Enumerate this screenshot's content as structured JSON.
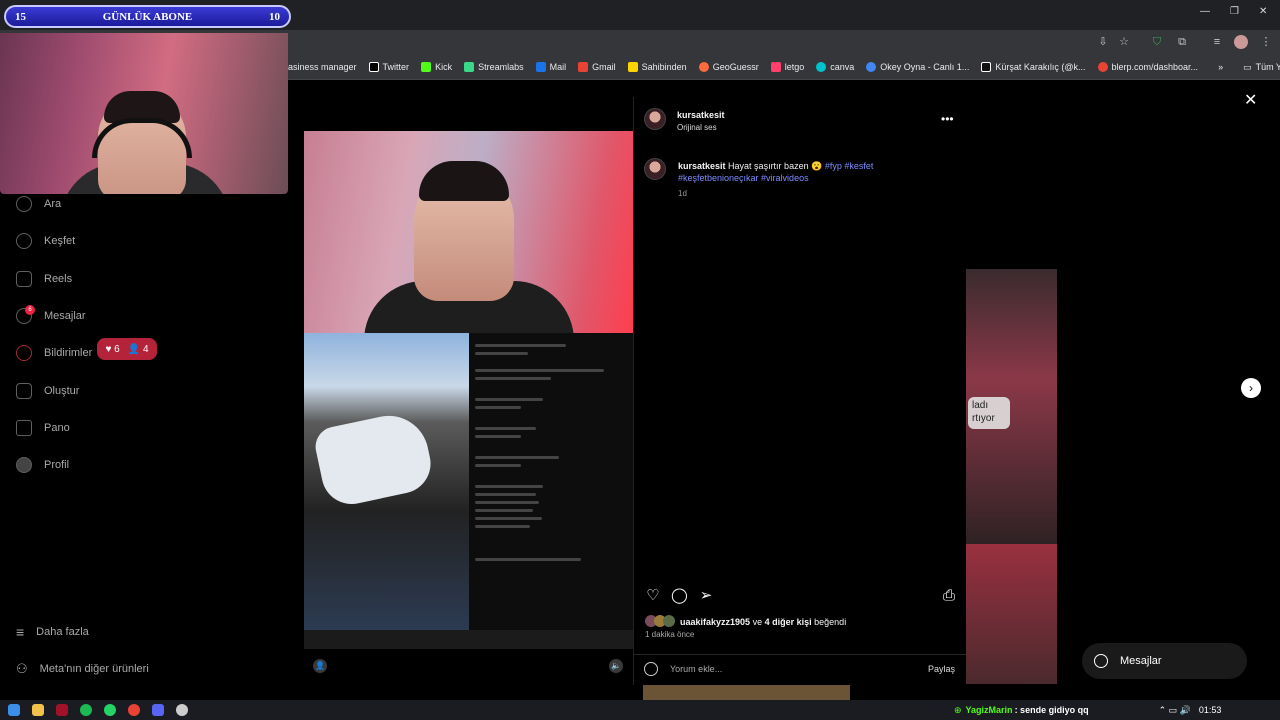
{
  "overlay": {
    "left_number": "15",
    "banner_text": "GÜNLÜK ABONE",
    "right_number": "10"
  },
  "bookmarks": [
    "asiness manager",
    "Twitter",
    "Kick",
    "Streamlabs",
    "Mail",
    "Gmail",
    "Sahibinden",
    "GeoGuessr",
    "letgo",
    "canva",
    "Okey Oyna - Canlı 1...",
    "Kürşat Karakılıç (@k...",
    "blerp.com/dashboar...",
    "Tüm Yer İşaretleri"
  ],
  "bookmark_colors": [
    "#8ab4f8",
    "#ffffff",
    "#53fc18",
    "#39d98a",
    "#1a73e8",
    "#ea4335",
    "#ffd400",
    "#ff6a3d",
    "#ff3f6c",
    "#00c4cc",
    "#4285f4",
    "#ffffff",
    "#ea4335"
  ],
  "sidebar": {
    "items": [
      {
        "label": "Ara",
        "icon": "search-icon"
      },
      {
        "label": "Keşfet",
        "icon": "compass-icon"
      },
      {
        "label": "Reels",
        "icon": "reels-icon"
      },
      {
        "label": "Mesajlar",
        "icon": "messenger-icon",
        "badge": "6"
      },
      {
        "label": "Bildirimler",
        "icon": "heart-icon"
      },
      {
        "label": "Oluştur",
        "icon": "plus-icon"
      },
      {
        "label": "Pano",
        "icon": "chart-icon"
      },
      {
        "label": "Profil",
        "icon": "avatar-icon"
      }
    ],
    "more": "Daha fazla",
    "meta": "Meta'nın diğer ürünleri",
    "notif_likes": "6",
    "notif_follows": "4"
  },
  "post": {
    "username": "kursatkesit",
    "audio": "Orijinal ses",
    "caption_user": "kursatkesit",
    "caption_text": "Hayat şaşırtır bazen 😮",
    "caption_tags": "#fyp #kesfet #keşfetbenioneçıkar #viralvideos",
    "caption_time": "1d",
    "liked_by_user": "uaakifakyzz1905",
    "liked_by_rest": "ve",
    "liked_by_others": "4 diğer kişi",
    "liked_by_suffix": "beğendi",
    "posted_ago": "1 dakika önce",
    "comment_placeholder": "Yorum ekle...",
    "post_button": "Paylaş"
  },
  "side_grid": {
    "text_snippet1": "ladı",
    "text_snippet2": "rtıyor"
  },
  "messages_pill": "Mesajlar",
  "taskbar": {
    "chat_user": "YagizMarin",
    "chat_text": ": sende gidiyo qq",
    "time": "01:53"
  }
}
